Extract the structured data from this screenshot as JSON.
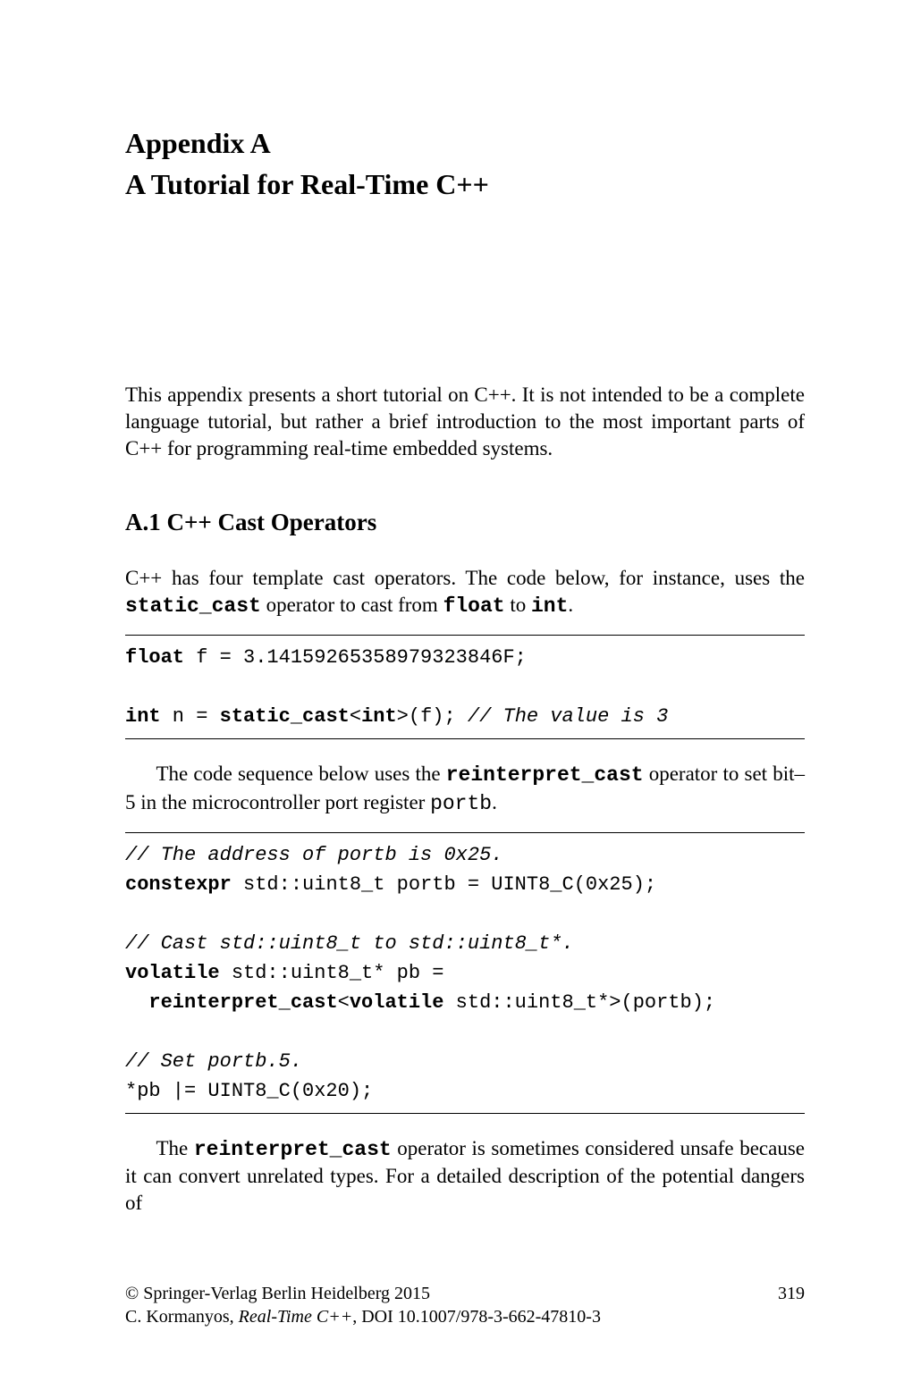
{
  "appendix": {
    "label": "Appendix A",
    "title": "A Tutorial for Real-Time C++"
  },
  "intro": "This appendix presents a short tutorial on C++. It is not intended to be a complete language tutorial, but rather a brief introduction to the most important parts of C++ for programming real-time embedded systems.",
  "section": {
    "heading": "A.1  C++ Cast Operators",
    "intro_pre": "C++ has four template cast operators. The code below, for instance, uses the ",
    "intro_code1": "static_cast",
    "intro_mid1": " operator to cast from ",
    "intro_code2": "float",
    "intro_mid2": " to ",
    "intro_code3": "int",
    "intro_post": "."
  },
  "code1": {
    "line1_kw": "float",
    "line1_rest": " f = 3.14159265358979323846F;",
    "line2_kw1": "int",
    "line2_mid1": " n = ",
    "line2_kw2": "static_cast",
    "line2_mid2": "<",
    "line2_kw3": "int",
    "line2_mid3": ">(f); ",
    "line2_comment": "// The value is 3"
  },
  "para1": {
    "pre": "The code sequence below uses the ",
    "code": "reinterpret_cast",
    "mid": " operator to set bit–5 in the microcontroller port register ",
    "mono": "portb",
    "post": "."
  },
  "code2": {
    "c1": "// The address of portb is 0x25.",
    "l2_kw": "constexpr",
    "l2_rest": " std::uint8_t portb = UINT8_C(0x25);",
    "c2": "// Cast std::uint8_t to std::uint8_t*.",
    "l4_kw": "volatile",
    "l4_rest": " std::uint8_t* pb =",
    "l5_pre": "  ",
    "l5_kw1": "reinterpret_cast",
    "l5_mid1": "<",
    "l5_kw2": "volatile",
    "l5_rest": " std::uint8_t*>(portb);",
    "c3": "// Set portb.5.",
    "l7": "*pb |= UINT8_C(0x20);"
  },
  "para2": {
    "pre": "The ",
    "code": "reinterpret_cast",
    "post": " operator is sometimes considered unsafe because it can convert unrelated types. For a detailed description of the potential dangers of"
  },
  "footer": {
    "copyright": "© Springer-Verlag Berlin Heidelberg 2015",
    "page": "319",
    "citation_author": "C. Kormanyos, ",
    "citation_title": "Real-Time C++",
    "citation_doi": ", DOI 10.1007/978-3-662-47810-3"
  }
}
